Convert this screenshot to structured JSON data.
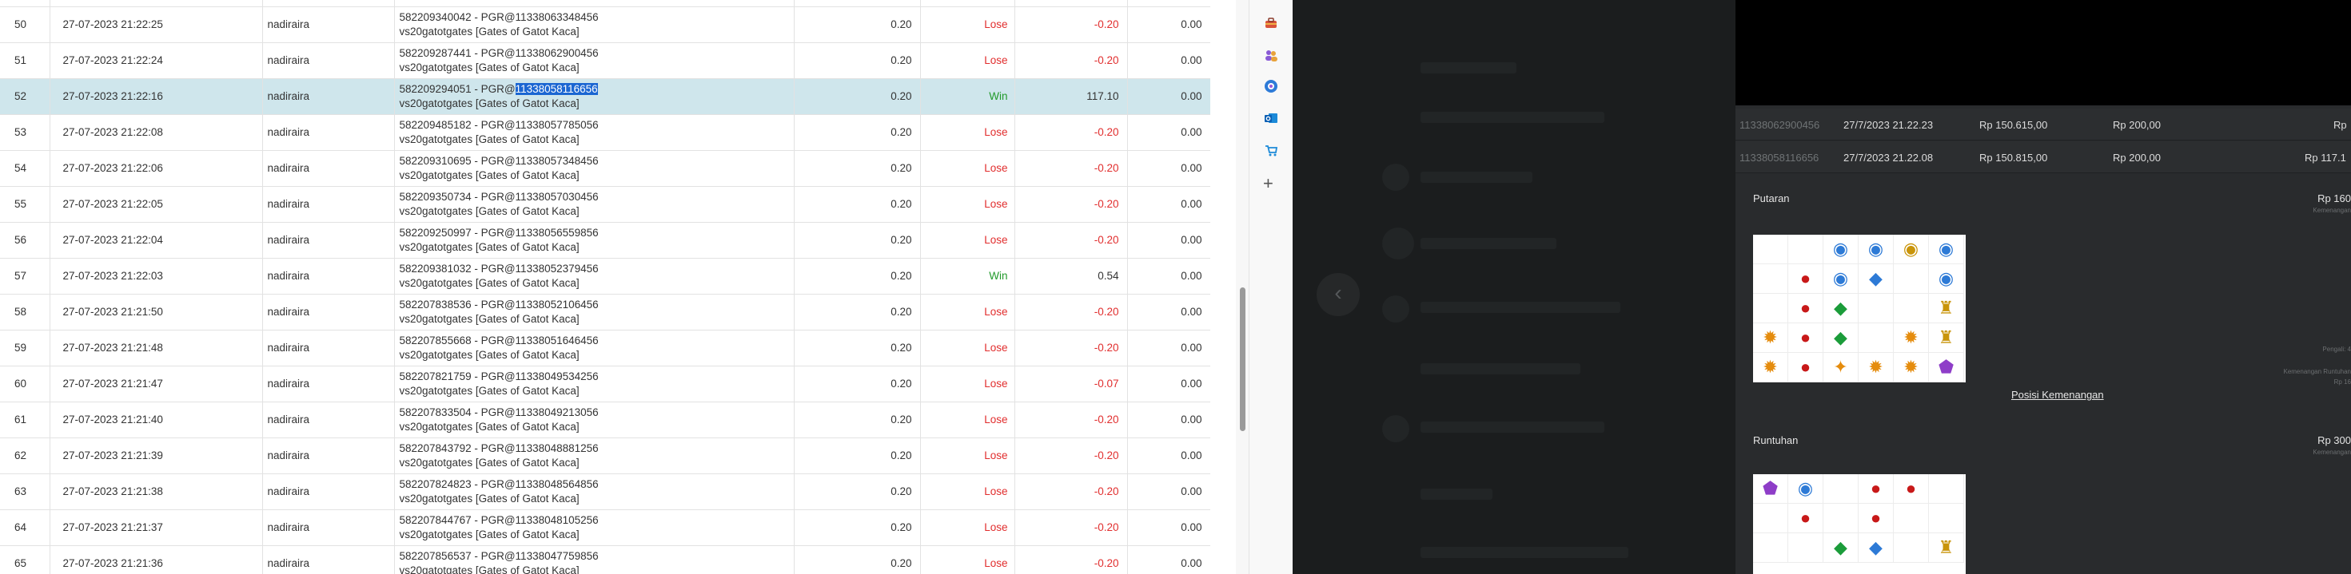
{
  "bets_table": {
    "rows": [
      {
        "num": "50",
        "datetime": "27-07-2023 21:22:25",
        "user": "nadiraira",
        "detail_id": "582209340042 - PGR@11338063348456",
        "detail_game": "vs20gatotgates [Gates of Gatot Kaca]",
        "stake": "0.20",
        "result": "Lose",
        "win": "-0.20",
        "balance": "0.00"
      },
      {
        "num": "51",
        "datetime": "27-07-2023 21:22:24",
        "user": "nadiraira",
        "detail_id": "582209287441 - PGR@11338062900456",
        "detail_game": "vs20gatotgates [Gates of Gatot Kaca]",
        "stake": "0.20",
        "result": "Lose",
        "win": "-0.20",
        "balance": "0.00"
      },
      {
        "num": "52",
        "datetime": "27-07-2023 21:22:16",
        "user": "nadiraira",
        "detail_id_prefix": "582209294051 - PGR@",
        "detail_id_highlight": "11338058116656",
        "detail_game": "vs20gatotgates [Gates of Gatot Kaca]",
        "stake": "0.20",
        "result": "Win",
        "win": "117.10",
        "balance": "0.00",
        "selected": true
      },
      {
        "num": "53",
        "datetime": "27-07-2023 21:22:08",
        "user": "nadiraira",
        "detail_id": "582209485182 - PGR@11338057785056",
        "detail_game": "vs20gatotgates [Gates of Gatot Kaca]",
        "stake": "0.20",
        "result": "Lose",
        "win": "-0.20",
        "balance": "0.00"
      },
      {
        "num": "54",
        "datetime": "27-07-2023 21:22:06",
        "user": "nadiraira",
        "detail_id": "582209310695 - PGR@11338057348456",
        "detail_game": "vs20gatotgates [Gates of Gatot Kaca]",
        "stake": "0.20",
        "result": "Lose",
        "win": "-0.20",
        "balance": "0.00"
      },
      {
        "num": "55",
        "datetime": "27-07-2023 21:22:05",
        "user": "nadiraira",
        "detail_id": "582209350734 - PGR@11338057030456",
        "detail_game": "vs20gatotgates [Gates of Gatot Kaca]",
        "stake": "0.20",
        "result": "Lose",
        "win": "-0.20",
        "balance": "0.00"
      },
      {
        "num": "56",
        "datetime": "27-07-2023 21:22:04",
        "user": "nadiraira",
        "detail_id": "582209250997 - PGR@11338056559856",
        "detail_game": "vs20gatotgates [Gates of Gatot Kaca]",
        "stake": "0.20",
        "result": "Lose",
        "win": "-0.20",
        "balance": "0.00"
      },
      {
        "num": "57",
        "datetime": "27-07-2023 21:22:03",
        "user": "nadiraira",
        "detail_id": "582209381032 - PGR@11338052379456",
        "detail_game": "vs20gatotgates [Gates of Gatot Kaca]",
        "stake": "0.20",
        "result": "Win",
        "win": "0.54",
        "balance": "0.00"
      },
      {
        "num": "58",
        "datetime": "27-07-2023 21:21:50",
        "user": "nadiraira",
        "detail_id": "582207838536 - PGR@11338052106456",
        "detail_game": "vs20gatotgates [Gates of Gatot Kaca]",
        "stake": "0.20",
        "result": "Lose",
        "win": "-0.20",
        "balance": "0.00"
      },
      {
        "num": "59",
        "datetime": "27-07-2023 21:21:48",
        "user": "nadiraira",
        "detail_id": "582207855668 - PGR@11338051646456",
        "detail_game": "vs20gatotgates [Gates of Gatot Kaca]",
        "stake": "0.20",
        "result": "Lose",
        "win": "-0.20",
        "balance": "0.00"
      },
      {
        "num": "60",
        "datetime": "27-07-2023 21:21:47",
        "user": "nadiraira",
        "detail_id": "582207821759 - PGR@11338049534256",
        "detail_game": "vs20gatotgates [Gates of Gatot Kaca]",
        "stake": "0.20",
        "result": "Lose",
        "win": "-0.07",
        "balance": "0.00"
      },
      {
        "num": "61",
        "datetime": "27-07-2023 21:21:40",
        "user": "nadiraira",
        "detail_id": "582207833504 - PGR@11338049213056",
        "detail_game": "vs20gatotgates [Gates of Gatot Kaca]",
        "stake": "0.20",
        "result": "Lose",
        "win": "-0.20",
        "balance": "0.00"
      },
      {
        "num": "62",
        "datetime": "27-07-2023 21:21:39",
        "user": "nadiraira",
        "detail_id": "582207843792 - PGR@11338048881256",
        "detail_game": "vs20gatotgates [Gates of Gatot Kaca]",
        "stake": "0.20",
        "result": "Lose",
        "win": "-0.20",
        "balance": "0.00"
      },
      {
        "num": "63",
        "datetime": "27-07-2023 21:21:38",
        "user": "nadiraira",
        "detail_id": "582207824823 - PGR@11338048564856",
        "detail_game": "vs20gatotgates [Gates of Gatot Kaca]",
        "stake": "0.20",
        "result": "Lose",
        "win": "-0.20",
        "balance": "0.00"
      },
      {
        "num": "64",
        "datetime": "27-07-2023 21:21:37",
        "user": "nadiraira",
        "detail_id": "582207844767 - PGR@11338048105256",
        "detail_game": "vs20gatotgates [Gates of Gatot Kaca]",
        "stake": "0.20",
        "result": "Lose",
        "win": "-0.20",
        "balance": "0.00"
      },
      {
        "num": "65",
        "datetime": "27-07-2023 21:21:36",
        "user": "nadiraira",
        "detail_id": "582207856537 - PGR@11338047759856",
        "detail_game": "vs20gatotgates [Gates of Gatot Kaca]",
        "stake": "0.20",
        "result": "Lose",
        "win": "-0.20",
        "balance": "0.00"
      }
    ]
  },
  "side_bar": {
    "icons": [
      "toolbox-icon",
      "people-icon",
      "copilot-icon",
      "outlook-icon",
      "shopping-icon"
    ],
    "add_symbol": "+"
  },
  "game_detail": {
    "transactions": [
      {
        "id": "11338062900456",
        "datetime": "27/7/2023 21.22.23",
        "balance": "Rp 150.615,00",
        "bet": "Rp 200,00",
        "win": "Rp"
      },
      {
        "id": "11338058116656",
        "datetime": "27/7/2023 21.22.08",
        "balance": "Rp 150.815,00",
        "bet": "Rp 200,00",
        "win": "Rp 117.1"
      }
    ],
    "spin": {
      "title": "Putaran",
      "amount": "Rp 160",
      "amount_sub": "Kemenangan",
      "note_1": "Pengali: 4",
      "note_2": "Kemenangan Runtuhan",
      "note_3": "Rp 16",
      "link": "Posisi Kemenangan",
      "grid": [
        [
          "",
          "",
          "orb-blue",
          "orb-blue",
          "orb-gold",
          "orb-blue"
        ],
        [
          "",
          "ruby",
          "orb-blue",
          "gem-blue",
          "",
          "orb-blue"
        ],
        [
          "",
          "ruby",
          "emerald",
          "",
          "",
          "trophy"
        ],
        [
          "sun",
          "ruby",
          "emerald",
          "",
          "sun",
          "trophy"
        ],
        [
          "sun",
          "ruby-text",
          "flame",
          "sun",
          "sun",
          "amethyst"
        ]
      ]
    },
    "tumble": {
      "title": "Runtuhan",
      "amount": "Rp 300",
      "amount_sub": "Kemenangan",
      "grid": [
        [
          "amethyst",
          "orb-blue",
          "",
          "ruby",
          "ruby",
          ""
        ],
        [
          "",
          "ruby",
          "",
          "ruby",
          "",
          ""
        ],
        [
          "",
          "",
          "emerald",
          "gem-blue",
          "",
          "trophy"
        ]
      ]
    }
  },
  "colors": {
    "lose": "#e12d2d",
    "win": "#229a2b",
    "selected_row": "#cfe6ec",
    "text_highlight": "#1b66d2",
    "dark_bg": "#1b1d1e",
    "panel_bg": "#292b2d"
  }
}
